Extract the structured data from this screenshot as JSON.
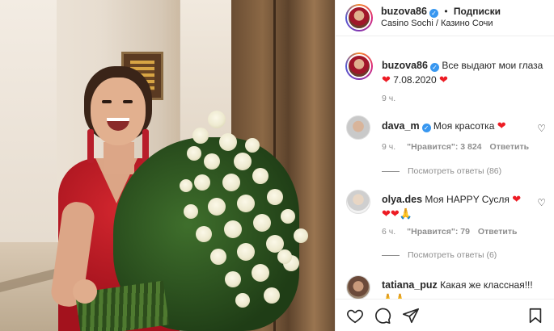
{
  "post": {
    "username": "buzova86",
    "follow_label": "Подписки",
    "separator": "•",
    "location": "Casino Sochi / Казино Сочи",
    "caption_text": "Все выдают мои глаза",
    "caption_date": "7.08.2020",
    "heart_glyph": "❤",
    "time": "9 ч."
  },
  "comments": [
    {
      "username": "dava_m",
      "verified": true,
      "text": "Моя красотка",
      "emoji": "❤",
      "time": "9 ч.",
      "likes": "\"Нравится\": 3 824",
      "reply": "Ответить",
      "replies": "Посмотреть ответы (86)"
    },
    {
      "username": "olya.des",
      "verified": false,
      "text": "Моя HAPPY Сусля",
      "emoji": "❤",
      "emoji_line": "❤❤🙏",
      "time": "6 ч.",
      "likes": "\"Нравится\": 79",
      "reply": "Ответить",
      "replies": "Посмотреть ответы (6)"
    },
    {
      "username": "tatiana_puz",
      "verified": false,
      "text": "Какая же классная!!!",
      "emoji_line": "🙏🙏"
    }
  ],
  "icons": {
    "verified": "verified-badge-icon",
    "like": "heart-outline-icon",
    "comment": "comment-icon",
    "share": "share-icon",
    "save": "bookmark-icon"
  },
  "colors": {
    "verified": "#3897f0",
    "heart": "#ed1c24",
    "muted": "#8e8e8e",
    "text": "#262626",
    "dress": "#c01f2a"
  }
}
